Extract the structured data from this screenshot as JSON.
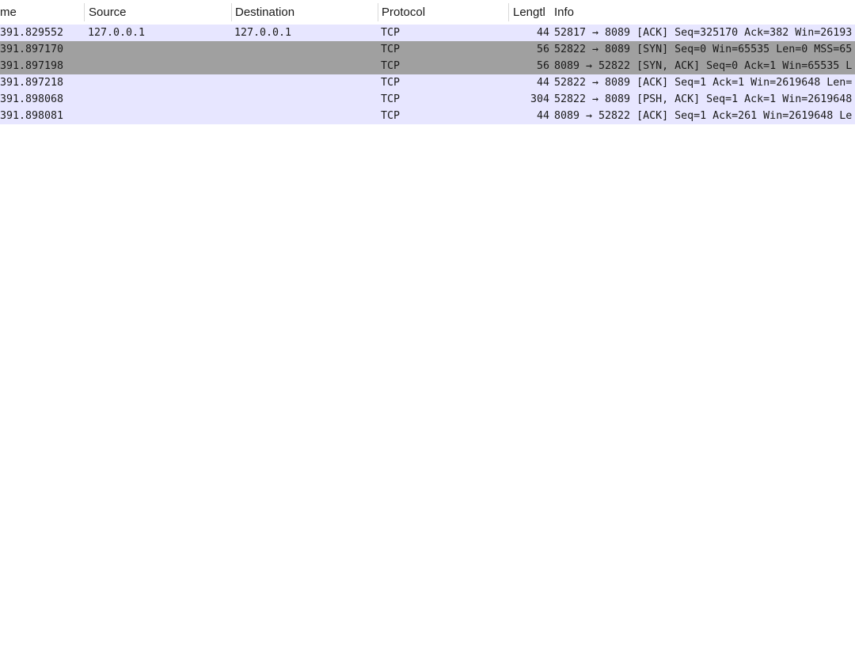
{
  "packet_list": {
    "columns": [
      "me",
      "Source",
      "Destination",
      "Protocol",
      "Lengtl",
      "Info"
    ],
    "rows": [
      {
        "time": "391.829552",
        "src": "127.0.0.1",
        "dst": "127.0.0.1",
        "proto": "TCP",
        "len": "44",
        "info": "52817 → 8089 [ACK] Seq=325170 Ack=382 Win=26193",
        "style": "band"
      },
      {
        "time": "391.897170",
        "src": "",
        "dst": "",
        "proto": "TCP",
        "len": "56",
        "info": "52822 → 8089 [SYN] Seq=0 Win=65535 Len=0 MSS=65",
        "style": "gray"
      },
      {
        "time": "391.897198",
        "src": "",
        "dst": "",
        "proto": "TCP",
        "len": "56",
        "info": "8089 → 52822 [SYN, ACK] Seq=0 Ack=1 Win=65535 L",
        "style": "gray"
      },
      {
        "time": "391.897218",
        "src": "",
        "dst": "",
        "proto": "TCP",
        "len": "44",
        "info": "52822 → 8089 [ACK] Seq=1 Ack=1 Win=2619648 Len=",
        "style": "band"
      },
      {
        "time": "391.898068",
        "src": "",
        "dst": "",
        "proto": "TCP",
        "len": "304",
        "info": "52822 → 8089 [PSH, ACK] Seq=1 Ack=1 Win=2619648",
        "style": "band"
      },
      {
        "time": "391.898081",
        "src": "",
        "dst": "",
        "proto": "TCP",
        "len": "44",
        "info": "8089 → 52822 [ACK] Seq=1 Ack=261 Win=2619648 Le",
        "style": "band"
      }
    ]
  }
}
